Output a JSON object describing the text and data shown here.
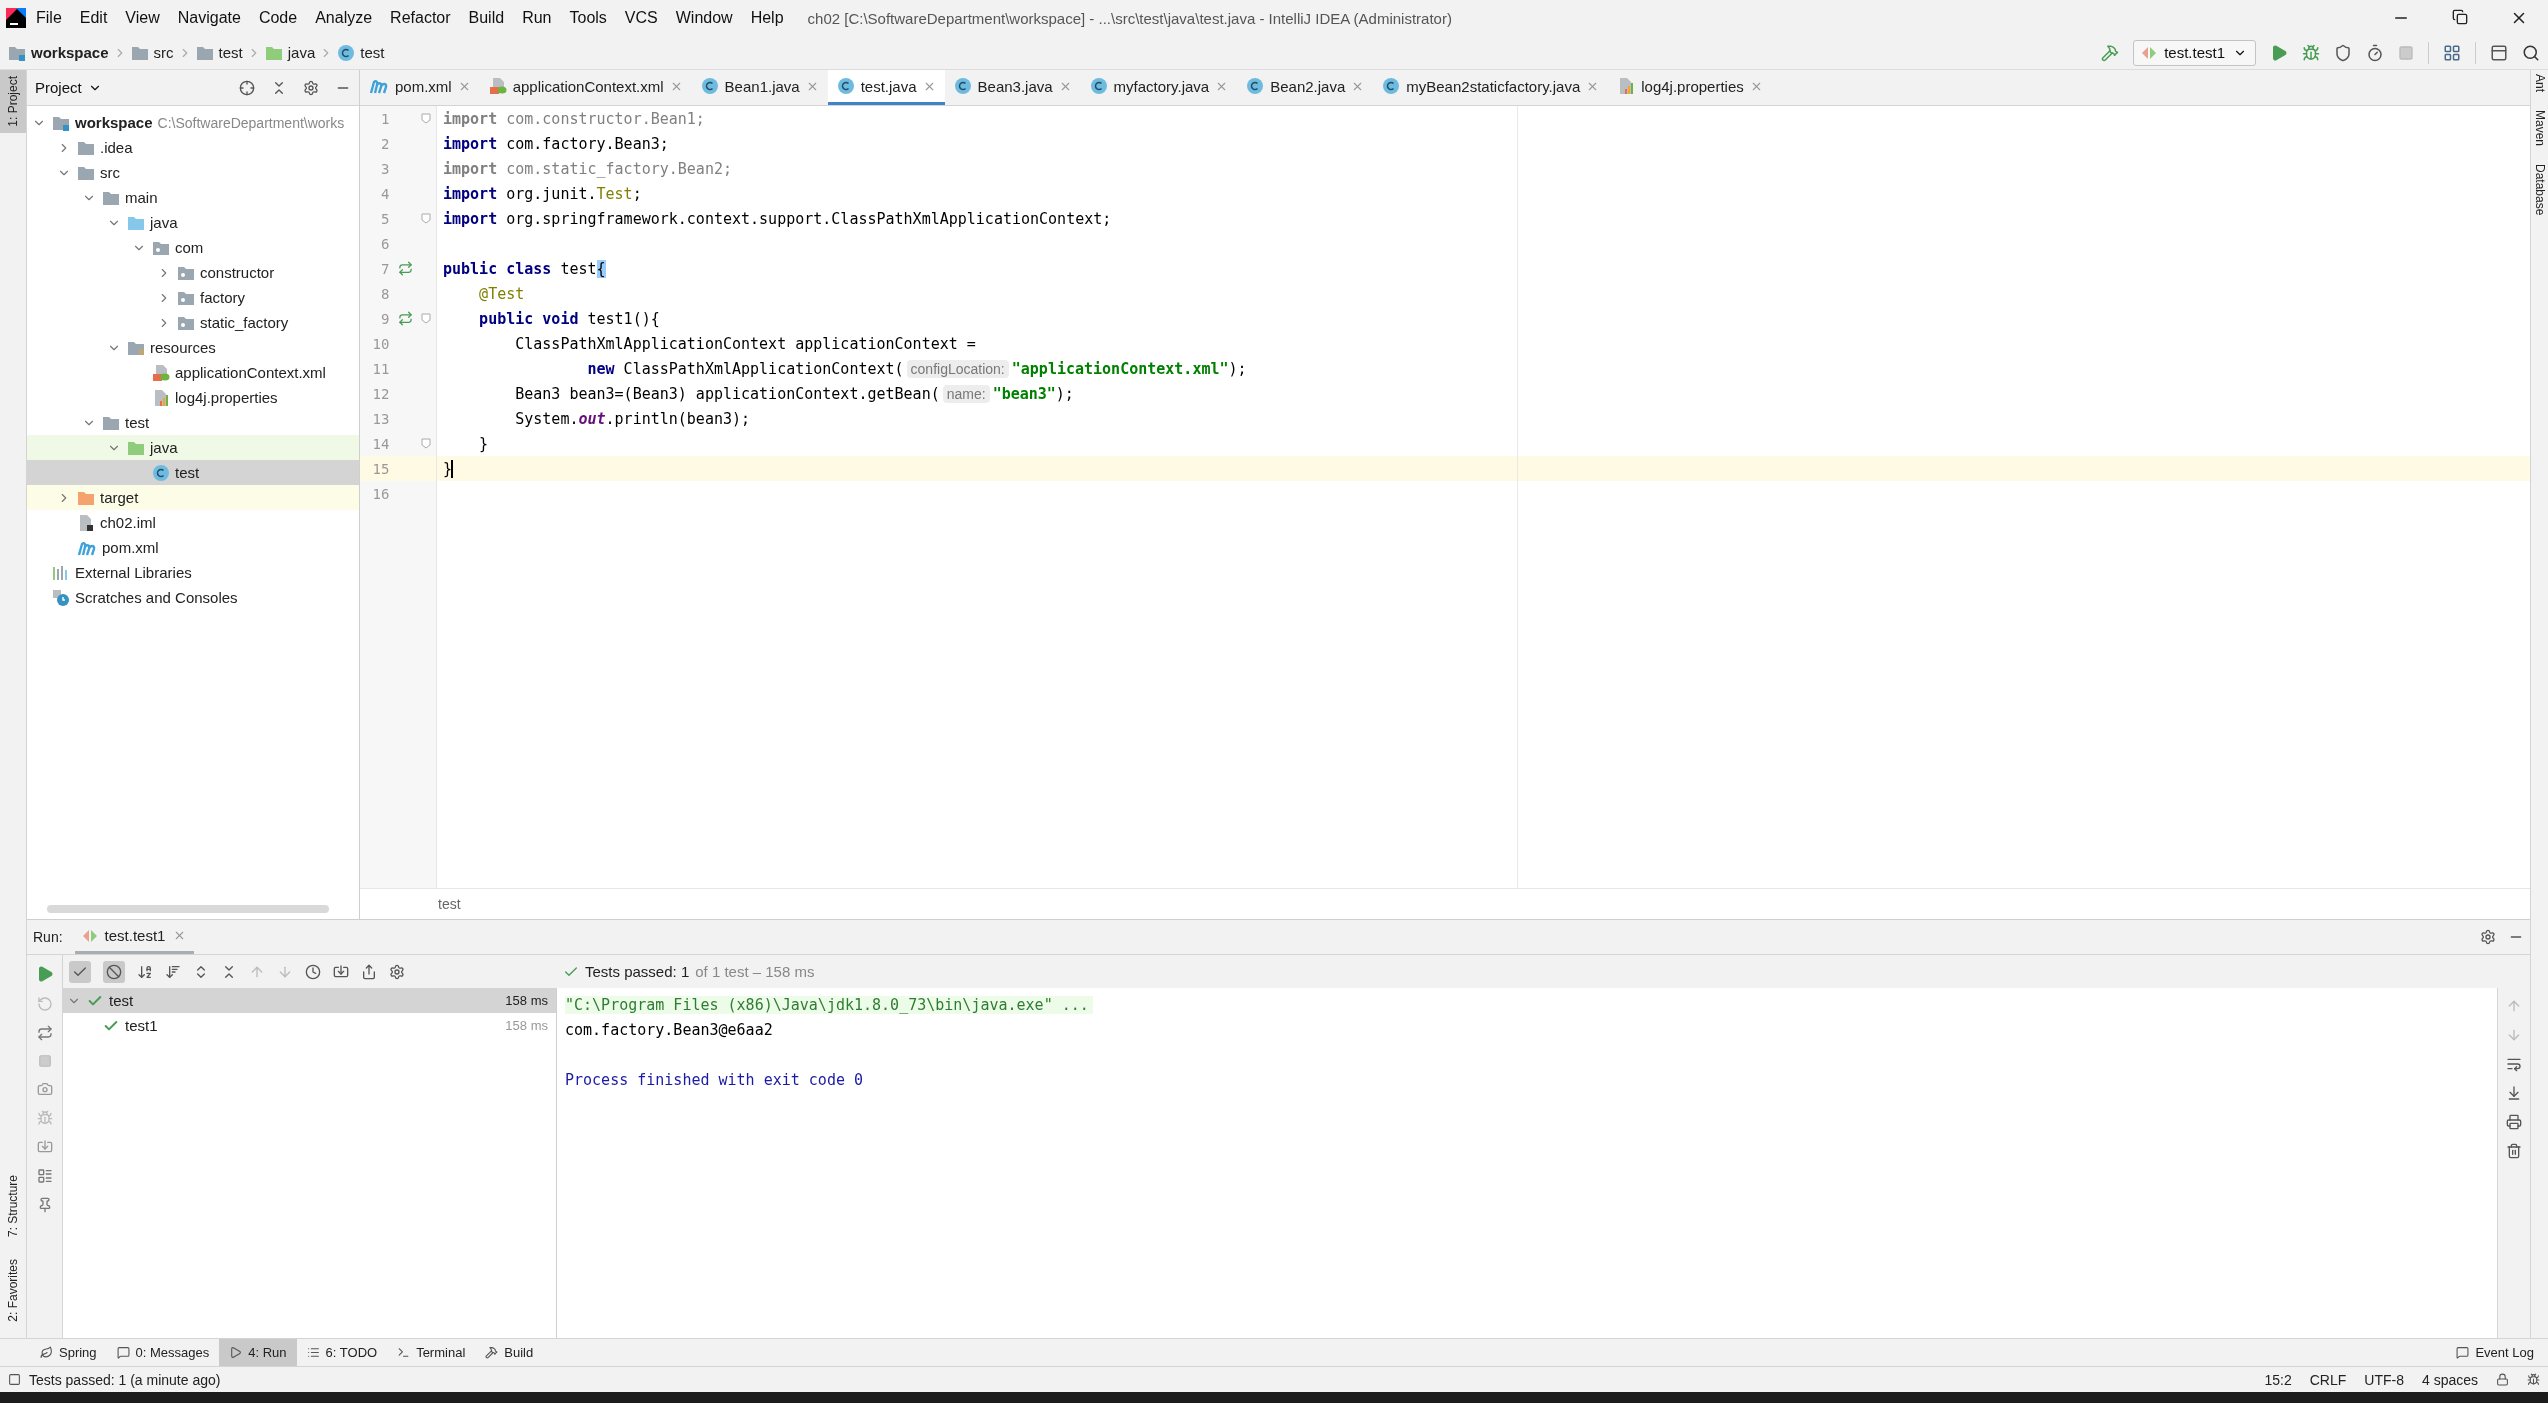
{
  "window": {
    "title": "ch02 [C:\\SoftwareDepartment\\workspace] - ...\\src\\test\\java\\test.java - IntelliJ IDEA (Administrator)"
  },
  "menu": [
    "File",
    "Edit",
    "View",
    "Navigate",
    "Code",
    "Analyze",
    "Refactor",
    "Build",
    "Run",
    "Tools",
    "VCS",
    "Window",
    "Help"
  ],
  "breadcrumbs": [
    {
      "label": "workspace",
      "kind": "module"
    },
    {
      "label": "src",
      "kind": "folder"
    },
    {
      "label": "test",
      "kind": "folder"
    },
    {
      "label": "java",
      "kind": "test-root"
    },
    {
      "label": "test",
      "kind": "class"
    }
  ],
  "run_config": {
    "label": "test.test1"
  },
  "left_strip": [
    {
      "label": "1: Project",
      "selected": true
    },
    {
      "label": "7: Structure",
      "selected": false
    },
    {
      "label": "2: Favorites",
      "selected": false
    }
  ],
  "right_strip": [
    {
      "label": "Ant"
    },
    {
      "label": "Maven"
    },
    {
      "label": "Database"
    }
  ],
  "project_panel": {
    "title": "Project",
    "tree": [
      {
        "label": "workspace",
        "path": "C:\\SoftwareDepartment\\works",
        "kind": "module",
        "expanded": true,
        "selected": false,
        "children": [
          {
            "label": ".idea",
            "kind": "folder",
            "expanded": false,
            "selected": false
          },
          {
            "label": "src",
            "kind": "folder",
            "expanded": true,
            "selected": false,
            "children": [
              {
                "label": "main",
                "kind": "folder",
                "expanded": true,
                "selected": false,
                "children": [
                  {
                    "label": "java",
                    "kind": "source-root",
                    "expanded": true,
                    "selected": false,
                    "children": [
                      {
                        "label": "com",
                        "kind": "package",
                        "expanded": true,
                        "selected": false,
                        "children": [
                          {
                            "label": "constructor",
                            "kind": "package",
                            "expanded": false,
                            "selected": false
                          },
                          {
                            "label": "factory",
                            "kind": "package",
                            "expanded": false,
                            "selected": false
                          },
                          {
                            "label": "static_factory",
                            "kind": "package",
                            "expanded": false,
                            "selected": false
                          }
                        ]
                      }
                    ]
                  },
                  {
                    "label": "resources",
                    "kind": "resources-root",
                    "expanded": true,
                    "selected": false,
                    "children": [
                      {
                        "label": "applicationContext.xml",
                        "kind": "xml",
                        "selected": false
                      },
                      {
                        "label": "log4j.properties",
                        "kind": "properties",
                        "selected": false
                      }
                    ]
                  }
                ]
              },
              {
                "label": "test",
                "kind": "folder",
                "expanded": true,
                "selected": false,
                "children": [
                  {
                    "label": "java",
                    "kind": "test-root",
                    "expanded": true,
                    "selected": false,
                    "children": [
                      {
                        "label": "test",
                        "kind": "class",
                        "selected": true
                      }
                    ]
                  }
                ]
              }
            ]
          },
          {
            "label": "target",
            "kind": "excluded",
            "expanded": false,
            "selected": false
          },
          {
            "label": "ch02.iml",
            "kind": "iml",
            "selected": false
          },
          {
            "label": "pom.xml",
            "kind": "maven",
            "selected": false
          }
        ]
      },
      {
        "label": "External Libraries",
        "kind": "libraries",
        "selected": false
      },
      {
        "label": "Scratches and Consoles",
        "kind": "scratches",
        "selected": false
      }
    ]
  },
  "editor": {
    "tabs": [
      {
        "label": "pom.xml",
        "kind": "maven",
        "selected": false
      },
      {
        "label": "applicationContext.xml",
        "kind": "xml",
        "selected": false
      },
      {
        "label": "Bean1.java",
        "kind": "class",
        "selected": false
      },
      {
        "label": "test.java",
        "kind": "class",
        "selected": true
      },
      {
        "label": "Bean3.java",
        "kind": "class",
        "selected": false
      },
      {
        "label": "myfactory.java",
        "kind": "class",
        "selected": false
      },
      {
        "label": "Bean2.java",
        "kind": "class",
        "selected": false
      },
      {
        "label": "myBean2staticfactory.java",
        "kind": "class",
        "selected": false
      },
      {
        "label": "log4j.properties",
        "kind": "properties",
        "selected": false
      }
    ],
    "lines": [
      {
        "number": "1",
        "fold": true,
        "run": false,
        "current": false,
        "tokens": [
          {
            "kind": "unused-kw",
            "text": "import"
          },
          {
            "kind": "unused",
            "text": " com.constructor.Bean1;"
          }
        ]
      },
      {
        "number": "2",
        "fold": false,
        "run": false,
        "current": false,
        "tokens": [
          {
            "kind": "kw",
            "text": "import"
          },
          {
            "kind": "plain",
            "text": " com.factory.Bean3;"
          }
        ]
      },
      {
        "number": "3",
        "fold": false,
        "run": false,
        "current": false,
        "tokens": [
          {
            "kind": "unused-kw",
            "text": "import"
          },
          {
            "kind": "unused",
            "text": " com.static_factory.Bean2;"
          }
        ]
      },
      {
        "number": "4",
        "fold": false,
        "run": false,
        "current": false,
        "tokens": [
          {
            "kind": "kw",
            "text": "import"
          },
          {
            "kind": "plain",
            "text": " org.junit."
          },
          {
            "kind": "annotation",
            "text": "Test"
          },
          {
            "kind": "plain",
            "text": ";"
          }
        ]
      },
      {
        "number": "5",
        "fold": true,
        "run": false,
        "current": false,
        "tokens": [
          {
            "kind": "kw",
            "text": "import"
          },
          {
            "kind": "plain",
            "text": " org.springframework.context.support.ClassPathXmlApplicationContext;"
          }
        ]
      },
      {
        "number": "6",
        "fold": false,
        "run": false,
        "current": false
      },
      {
        "number": "7",
        "fold": false,
        "run": true,
        "current": false,
        "tokens": [
          {
            "kind": "kw",
            "text": "public class"
          },
          {
            "kind": "plain",
            "text": " test"
          },
          {
            "kind": "brace",
            "text": "{"
          }
        ]
      },
      {
        "number": "8",
        "fold": false,
        "run": false,
        "current": false,
        "tokens": [
          {
            "kind": "annotation",
            "text": "    @Test"
          }
        ]
      },
      {
        "number": "9",
        "fold": true,
        "run": true,
        "current": false,
        "tokens": [
          {
            "kind": "kw",
            "text": "    public void"
          },
          {
            "kind": "plain",
            "text": " test1(){"
          }
        ]
      },
      {
        "number": "10",
        "fold": false,
        "run": false,
        "current": false,
        "tokens": [
          {
            "kind": "plain",
            "text": "        ClassPathXmlApplicationContext applicationContext ="
          }
        ]
      },
      {
        "number": "11",
        "fold": false,
        "run": false,
        "current": false,
        "tokens": [
          {
            "kind": "kw",
            "text": "                new"
          },
          {
            "kind": "plain",
            "text": " ClassPathXmlApplicationContext("
          },
          {
            "kind": "hint",
            "text": "configLocation:"
          },
          {
            "kind": "string",
            "text": "\"applicationContext.xml\""
          },
          {
            "kind": "plain",
            "text": ");"
          }
        ]
      },
      {
        "number": "12",
        "fold": false,
        "run": false,
        "current": false,
        "tokens": [
          {
            "kind": "plain",
            "text": "        Bean3 bean3=(Bean3) applicationContext.getBean("
          },
          {
            "kind": "hint",
            "text": "name:"
          },
          {
            "kind": "string",
            "text": "\"bean3\""
          },
          {
            "kind": "plain",
            "text": ");"
          }
        ]
      },
      {
        "number": "13",
        "fold": false,
        "run": false,
        "current": false,
        "tokens": [
          {
            "kind": "plain",
            "text": "        System."
          },
          {
            "kind": "field",
            "text": "out"
          },
          {
            "kind": "plain",
            "text": ".println(bean3);"
          }
        ]
      },
      {
        "number": "14",
        "fold": true,
        "run": false,
        "current": false,
        "tokens": [
          {
            "kind": "plain",
            "text": "    }"
          }
        ]
      },
      {
        "number": "15",
        "fold": false,
        "run": false,
        "current": true,
        "tokens": [
          {
            "kind": "plain",
            "text": "}"
          }
        ]
      },
      {
        "number": "16",
        "fold": false,
        "run": false,
        "current": false
      }
    ],
    "breadcrumb": "test"
  },
  "run": {
    "title": "Run:",
    "tab": "test.test1",
    "show_passed": true,
    "show_ignored": true,
    "summary": "Tests passed: 1",
    "summary_detail": "of 1 test – 158 ms",
    "tests": [
      {
        "label": "test",
        "time": "158 ms",
        "passed": true,
        "expanded": true,
        "selected": true,
        "children": [
          {
            "label": "test1",
            "time": "158 ms",
            "passed": true,
            "selected": false
          }
        ]
      }
    ],
    "console": [
      {
        "kind": "command",
        "text": "\"C:\\Program Files (x86)\\Java\\jdk1.8.0_73\\bin\\java.exe\" ..."
      },
      {
        "kind": "output",
        "text": "com.factory.Bean3@e6aa2"
      },
      {
        "kind": "system",
        "text": "Process finished with exit code 0"
      }
    ]
  },
  "bottom_tabs": [
    {
      "label": "Spring",
      "selected": false
    },
    {
      "label": "0: Messages",
      "selected": false
    },
    {
      "label": "4: Run",
      "selected": true
    },
    {
      "label": "6: TODO",
      "selected": false
    },
    {
      "label": "Terminal",
      "selected": false
    },
    {
      "label": "Build",
      "selected": false
    }
  ],
  "event_log": "Event Log",
  "status_bar": {
    "message": "Tests passed: 1 (a minute ago)",
    "position": "15:2",
    "line_separator": "CRLF",
    "encoding": "UTF-8",
    "indent": "4 spaces"
  }
}
